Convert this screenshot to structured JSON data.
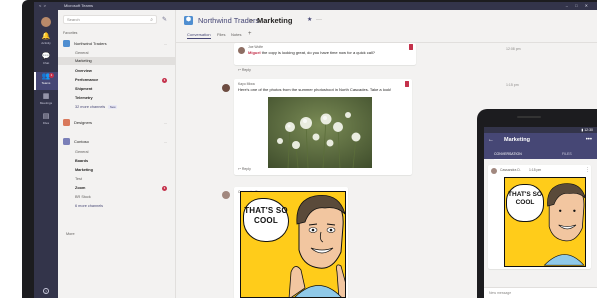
{
  "window": {
    "nav_back": "<",
    "nav_forward": ">",
    "title": "Microsoft Teams",
    "window_controls": "– □ ✕"
  },
  "rail": {
    "items": [
      {
        "label": "Activity",
        "icon": "bell-icon",
        "glyph": "🔔"
      },
      {
        "label": "Chat",
        "icon": "chat-icon",
        "glyph": "💬"
      },
      {
        "label": "Teams",
        "icon": "teams-icon",
        "glyph": "👥",
        "badge": "1"
      },
      {
        "label": "Meetings",
        "icon": "calendar-icon",
        "glyph": "▦"
      },
      {
        "label": "Files",
        "icon": "files-icon",
        "glyph": "▤"
      }
    ],
    "help": "?"
  },
  "sidebar": {
    "search_placeholder": "Search",
    "search_icon": "⌕",
    "compose_icon": "✎",
    "favorites_label": "Favorites",
    "teams": [
      {
        "name": "Northwind Traders",
        "color": "#4f8ed0",
        "more": "...",
        "channels": [
          {
            "label": "General",
            "bold": false
          },
          {
            "label": "Marketing",
            "bold": false,
            "active": true
          },
          {
            "label": "Overview",
            "bold": true
          },
          {
            "label": "Performance",
            "bold": true,
            "badge": "1"
          },
          {
            "label": "Shipment",
            "bold": true
          },
          {
            "label": "Telemetry",
            "bold": true
          },
          {
            "label": "32 more channels",
            "more": true,
            "tag": "New"
          }
        ]
      },
      {
        "name": "Designers",
        "color": "#d9795c",
        "more": "...",
        "channels": []
      },
      {
        "name": "Contoso",
        "color": "#7a7fb8",
        "more": "...",
        "channels": [
          {
            "label": "General",
            "bold": false
          },
          {
            "label": "Boards",
            "bold": true
          },
          {
            "label": "Marketing",
            "bold": true
          },
          {
            "label": "Test",
            "bold": false
          },
          {
            "label": "Zoom",
            "bold": true,
            "badge": "1"
          },
          {
            "label": "BR Stock",
            "bold": false
          },
          {
            "label": "6 more channels",
            "more": true
          }
        ]
      }
    ],
    "more_label": "More"
  },
  "header": {
    "team_name": "Northwind Traders",
    "separator": ">",
    "channel_name": "Marketing",
    "star": "★",
    "dots": "···",
    "tabs": [
      "Conversation",
      "Files",
      "Notes"
    ],
    "add_tab": "+"
  },
  "thread": {
    "messages": [
      {
        "author": "Joe Wolfe",
        "text_highlight": "Miguel",
        "text": " the copy is looking great, do you have time now for a quick call?",
        "time": "12:08 pm",
        "reply": "↩ Reply"
      },
      {
        "author": "Kayo Miwa",
        "text": "Here's one of the photos from the summer photoshoot in North Cascades. Take a look!",
        "time": "1:15 pm",
        "reply": "↩ Reply",
        "image_desc": "photo-white-wildflowers"
      },
      {
        "author": "Cassandra Dunn",
        "time": "1:15 pm",
        "meme_text": "THAT'S SO COOL"
      }
    ]
  },
  "phone": {
    "status_time": "12:30",
    "back": "←",
    "title": "Marketing",
    "more": "•••",
    "tabs": [
      "CONVERSATION",
      "FILES"
    ],
    "message_author": "Cassandra D.",
    "message_time": "1:15 pm",
    "message_more": "⋮",
    "meme_text": "THAT'S SO COOL",
    "compose_placeholder": "New message"
  },
  "colors": {
    "rail": "#33344a",
    "accent": "#464775",
    "badge": "#c4314b",
    "meme_yellow": "#ffcc1a"
  }
}
